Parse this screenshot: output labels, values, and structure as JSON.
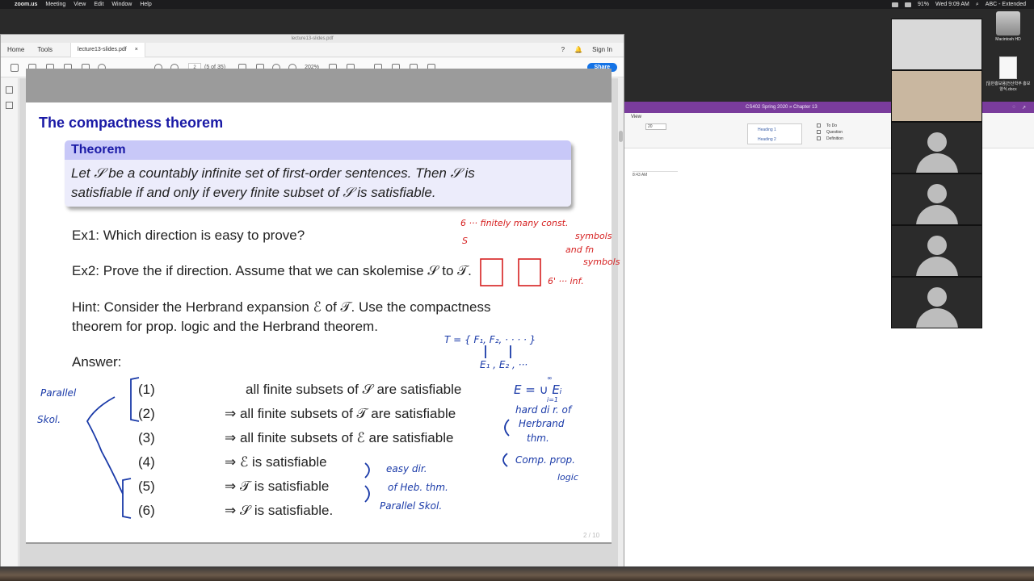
{
  "menubar": {
    "app": "zoom.us",
    "items": [
      "Meeting",
      "View",
      "Edit",
      "Window",
      "Help"
    ],
    "battery": "91%",
    "clock": "Wed 9:09 AM",
    "input_source": "ABC - Extended"
  },
  "acrobat": {
    "window_title": "lecture13-slides.pdf",
    "tab_home": "Home",
    "tab_tools": "Tools",
    "doc_tab": "lecture13-slides.pdf",
    "doc_tab_close": "×",
    "sign_in": "Sign In",
    "page_number": "2",
    "page_total": "(5 of 35)",
    "zoom": "202%",
    "share": "Share"
  },
  "slide": {
    "title": "The compactness theorem",
    "theorem_head": "Theorem",
    "theorem_line1": "Let 𝒮 be a countably infinite set of first-order sentences. Then 𝒮 is",
    "theorem_line2": "satisfiable if and only if every finite subset of 𝒮 is satisfiable.",
    "ex1": "Ex1: Which direction is easy to prove?",
    "ex2_a": "Ex2: Prove the if direction. Assume that we can skolemise ",
    "ex2_s": "𝒮",
    "ex2_to": " to ",
    "ex2_t": "𝒯",
    "ex2_end": ".",
    "hint_line1": "Hint: Consider the Herbrand expansion ℰ of 𝒯. Use the compactness",
    "hint_line2": "theorem for prop. logic and the Herbrand theorem.",
    "answer_label": "Answer:",
    "answers": [
      {
        "num": "(1)",
        "text": "all finite subsets of 𝒮 are satisfiable"
      },
      {
        "num": "(2)",
        "text": "⇒ all finite subsets of 𝒯 are satisfiable"
      },
      {
        "num": "(3)",
        "text": "⇒ all finite subsets of ℰ are satisfiable"
      },
      {
        "num": "(4)",
        "text": "⇒ ℰ is satisfiable"
      },
      {
        "num": "(5)",
        "text": "⇒ 𝒯 is satisfiable"
      },
      {
        "num": "(6)",
        "text": "⇒ 𝒮 is satisfiable."
      }
    ],
    "page_indicator": "2 / 10"
  },
  "annotations": {
    "red_1": "6 ··· finitely many const.",
    "red_2": "symbols",
    "red_3": "and fn",
    "red_4": "symbols",
    "red_5": "6' ··· inf.",
    "red_s": "S",
    "blue_T": "T = { F₁, F₂, · · · · }",
    "blue_E": "E₁ , E₂ , ···",
    "blue_union": "E = ∪ Eᵢ",
    "blue_inf": "∞",
    "blue_i": "i=1",
    "blue_hard": "hard di r. of",
    "blue_herbrand": "Herbrand",
    "blue_thm": "thm.",
    "blue_comp": "Comp. prop.",
    "blue_logic": "logic",
    "blue_easy": "easy dir.",
    "blue_of_heb": "of Heb. thm.",
    "blue_par_skol": "Parallel Skol.",
    "blue_parallel": "Parallel",
    "blue_skol": "Skol."
  },
  "onenote": {
    "title": "CS402 Spring 2020  »  Chapter 13",
    "view": "View",
    "font_size": "20",
    "heading1": "Heading 1",
    "heading2": "Heading 2",
    "tags": [
      "To Do",
      "Question",
      "Definition"
    ],
    "time": "8:43 AM"
  },
  "desktop": {
    "hd_label": "Macintosh HD",
    "doc_label": "[일반홍보용]전산학부 홍보양식.docx"
  },
  "colors": {
    "slide_title": "#1a1aa6",
    "theorem_head_bg": "#c8c8f8",
    "theorem_body_bg": "#ececfb",
    "ink_red": "#d62020",
    "ink_blue": "#1a3aa8",
    "onenote_purple": "#7a3c9c",
    "share_blue": "#1473e6"
  }
}
